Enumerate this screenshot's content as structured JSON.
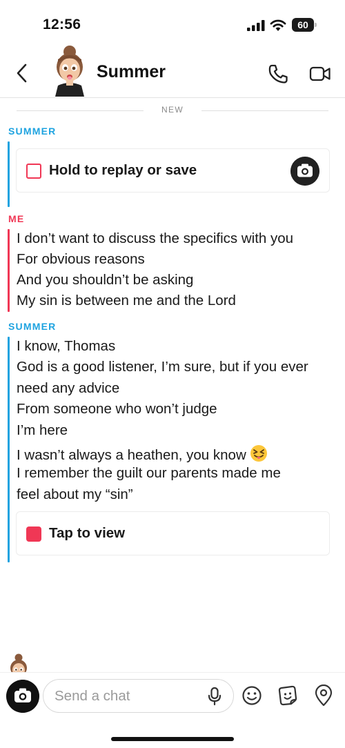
{
  "status_bar": {
    "time": "12:56",
    "battery_level": "60"
  },
  "header": {
    "contact_name": "Summer"
  },
  "divider": {
    "label": "NEW"
  },
  "conversation": {
    "groups": [
      {
        "sender": "SUMMER",
        "snap": {
          "label": "Hold to replay or save"
        }
      },
      {
        "sender": "ME",
        "lines": [
          " I don’t want to discuss the specifics with you",
          "For obvious reasons",
          "And you shouldn’t be asking",
          "My sin is between me and the Lord"
        ]
      },
      {
        "sender": "SUMMER",
        "lines": [
          "I know, Thomas",
          "God is a good listener, I’m sure, but if you ever",
          "need any advice",
          "From someone who won’t judge",
          "I’m here",
          "I wasn’t always a heathen, you know",
          "I remember the guilt our parents made me",
          "feel about my “sin”"
        ],
        "snap": {
          "label": "Tap to view"
        }
      }
    ]
  },
  "composer": {
    "placeholder": "Send a chat"
  },
  "colors": {
    "summer_accent": "#1ea3e0",
    "me_accent": "#f03755"
  },
  "icons": {
    "back": "chevron-left-icon",
    "call": "phone-icon",
    "video": "video-camera-icon",
    "camera": "camera-icon",
    "mic": "microphone-icon",
    "emoji": "smiley-icon",
    "sticker": "sticker-icon",
    "location": "location-pin-icon",
    "squinting_emoji": "squinting-tongue-emoji"
  }
}
